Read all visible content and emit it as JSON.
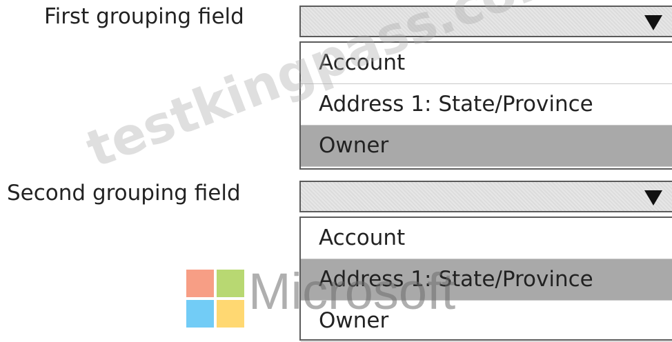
{
  "first_grouping": {
    "label": "First grouping field",
    "options": [
      "Account",
      "Address 1: State/Province",
      "Owner"
    ],
    "selected": "Owner"
  },
  "second_grouping": {
    "label": "Second grouping field",
    "options": [
      "Account",
      "Address 1: State/Province",
      "Owner"
    ],
    "selected": "Address 1: State/Province"
  },
  "watermark": {
    "text": "testkingpass.com",
    "brand": "Microsoft"
  },
  "colors": {
    "selected_background": "#a9a9a9",
    "dropdown_background": "#e2e2e2",
    "logo_red": "#f25022",
    "logo_green": "#7fba00",
    "logo_blue": "#00a4ef",
    "logo_yellow": "#ffb900"
  },
  "icons": {
    "dropdown_arrow": "chevron-down-icon",
    "logo": "microsoft-logo-icon"
  }
}
